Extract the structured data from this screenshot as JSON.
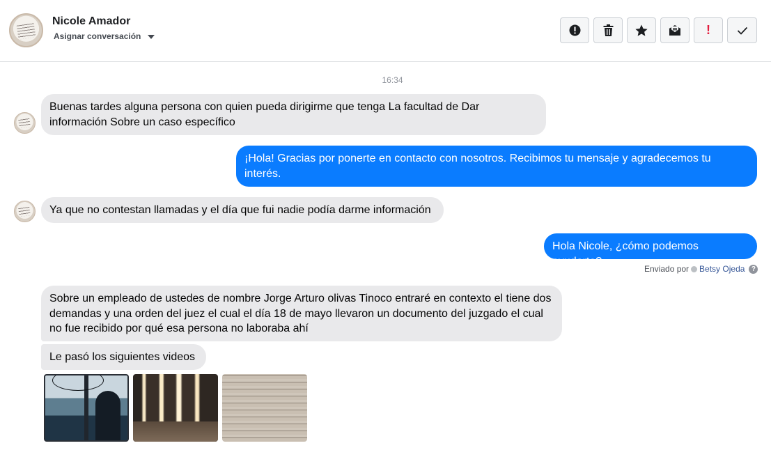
{
  "header": {
    "contact_name": "Nicole Amador",
    "assign_label": "Asignar conversación",
    "actions": [
      {
        "icon": "alert-circle-icon"
      },
      {
        "icon": "trash-icon"
      },
      {
        "icon": "star-icon"
      },
      {
        "icon": "mail-open-icon"
      },
      {
        "icon": "exclamation-icon",
        "text": "!"
      },
      {
        "icon": "check-icon"
      }
    ]
  },
  "thread": {
    "timestamp": "16:34",
    "messages": [
      {
        "direction": "incoming",
        "text": "Buenas tardes alguna persona con quien pueda dirigirme  que tenga La facultad  de   Dar información   Sobre un caso específico"
      },
      {
        "direction": "outgoing",
        "text": "¡Hola! Gracias por ponerte en contacto con nosotros. Recibimos tu mensaje y agradecemos tu interés."
      },
      {
        "direction": "incoming",
        "text": "Ya que no contestan llamadas  y el día que fui nadie podía  darme información"
      },
      {
        "direction": "outgoing",
        "text": "Hola Nicole, ¿cómo podemos ayudarte?"
      },
      {
        "direction": "incoming",
        "text": "Sobre un empleado  de ustedes de nombre Jorge Arturo olivas Tinoco  entraré en contexto  el tiene dos demandas  y una orden del juez el cual el día 18 de mayo llevaron un documento  del juzgado  el cual no fue recibido por qué esa persona no laboraba ahí"
      },
      {
        "direction": "incoming",
        "text": "Le pasó los siguientes  videos"
      }
    ],
    "sent_by": {
      "prefix": "Enviado por",
      "agent": "Betsy Ojeda",
      "help": "?"
    }
  },
  "colors": {
    "outgoing_bubble": "#0a7cff",
    "incoming_bubble": "#e9e9eb",
    "agent_link": "#385898",
    "exclamation": "#e41e3f"
  }
}
